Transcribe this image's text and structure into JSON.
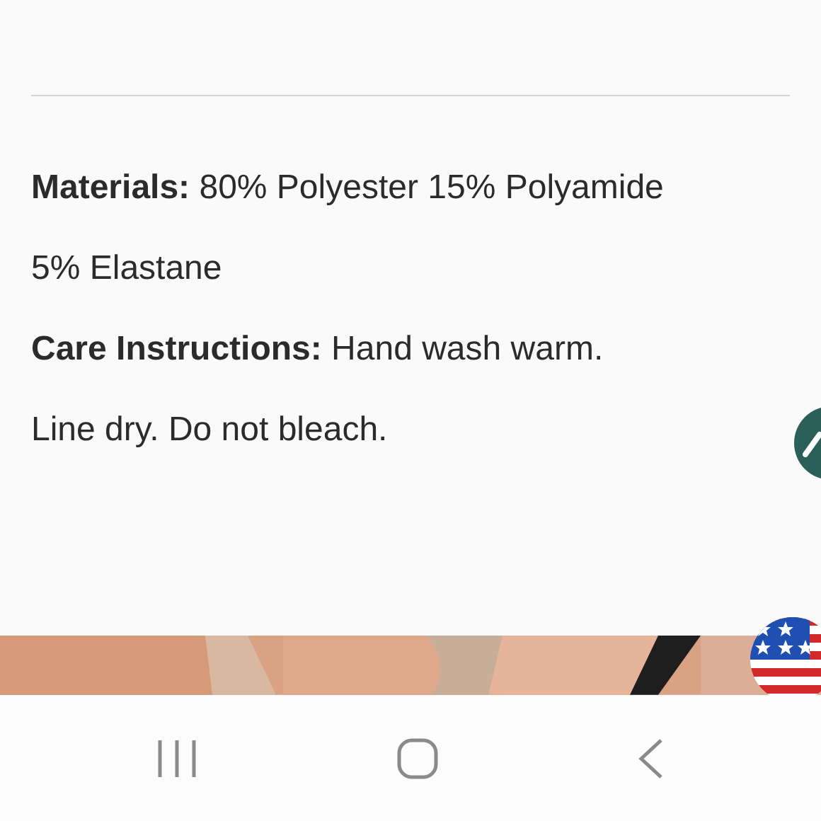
{
  "details": [
    {
      "text": "**Materials:** 80% Polyester 15% Polyamide 5% Elastane"
    },
    {
      "text": "**Care Instructions:** Hand wash warm. Line dry. Do not bleach."
    }
  ]
}
